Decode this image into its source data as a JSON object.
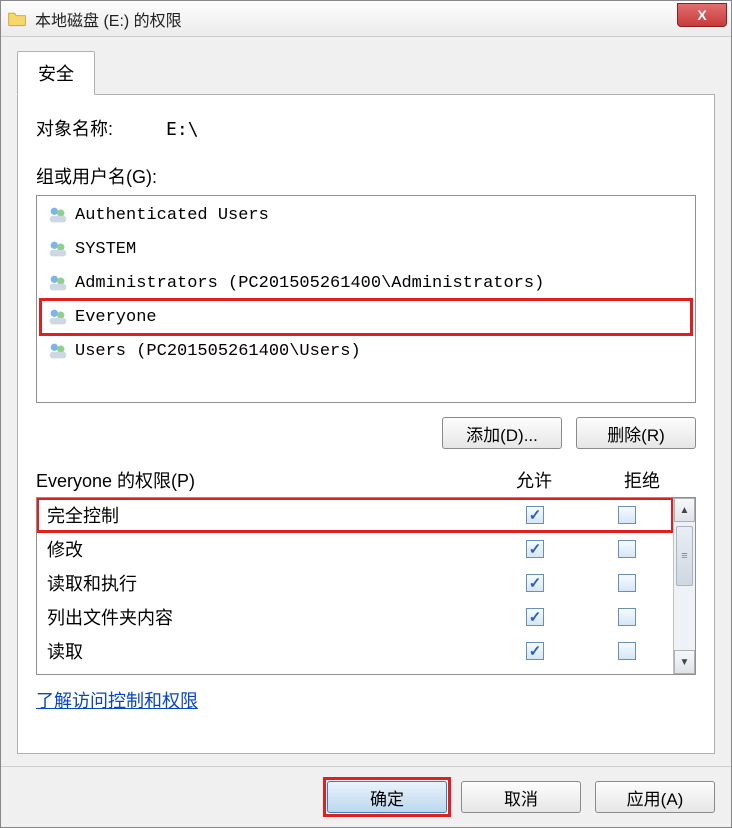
{
  "window": {
    "title": "本地磁盘 (E:) 的权限",
    "close_label": "X"
  },
  "tab": {
    "security": "安全"
  },
  "object_name": {
    "label": "对象名称:",
    "value": "E:\\"
  },
  "groups_label": "组或用户名(G):",
  "users": [
    {
      "name": "Authenticated Users"
    },
    {
      "name": "SYSTEM"
    },
    {
      "name": "Administrators (PC201505261400\\Administrators)"
    },
    {
      "name": "Everyone",
      "highlighted": true
    },
    {
      "name": "Users (PC201505261400\\Users)"
    }
  ],
  "buttons": {
    "add": "添加(D)...",
    "remove": "删除(R)"
  },
  "perm_header": {
    "title": "Everyone 的权限(P)",
    "allow": "允许",
    "deny": "拒绝"
  },
  "permissions": [
    {
      "name": "完全控制",
      "allow": true,
      "deny": false,
      "highlighted": true
    },
    {
      "name": "修改",
      "allow": true,
      "deny": false
    },
    {
      "name": "读取和执行",
      "allow": true,
      "deny": false
    },
    {
      "name": "列出文件夹内容",
      "allow": true,
      "deny": false
    },
    {
      "name": "读取",
      "allow": true,
      "deny": false
    }
  ],
  "link": "了解访问控制和权限",
  "footer": {
    "ok": "确定",
    "cancel": "取消",
    "apply": "应用(A)"
  }
}
